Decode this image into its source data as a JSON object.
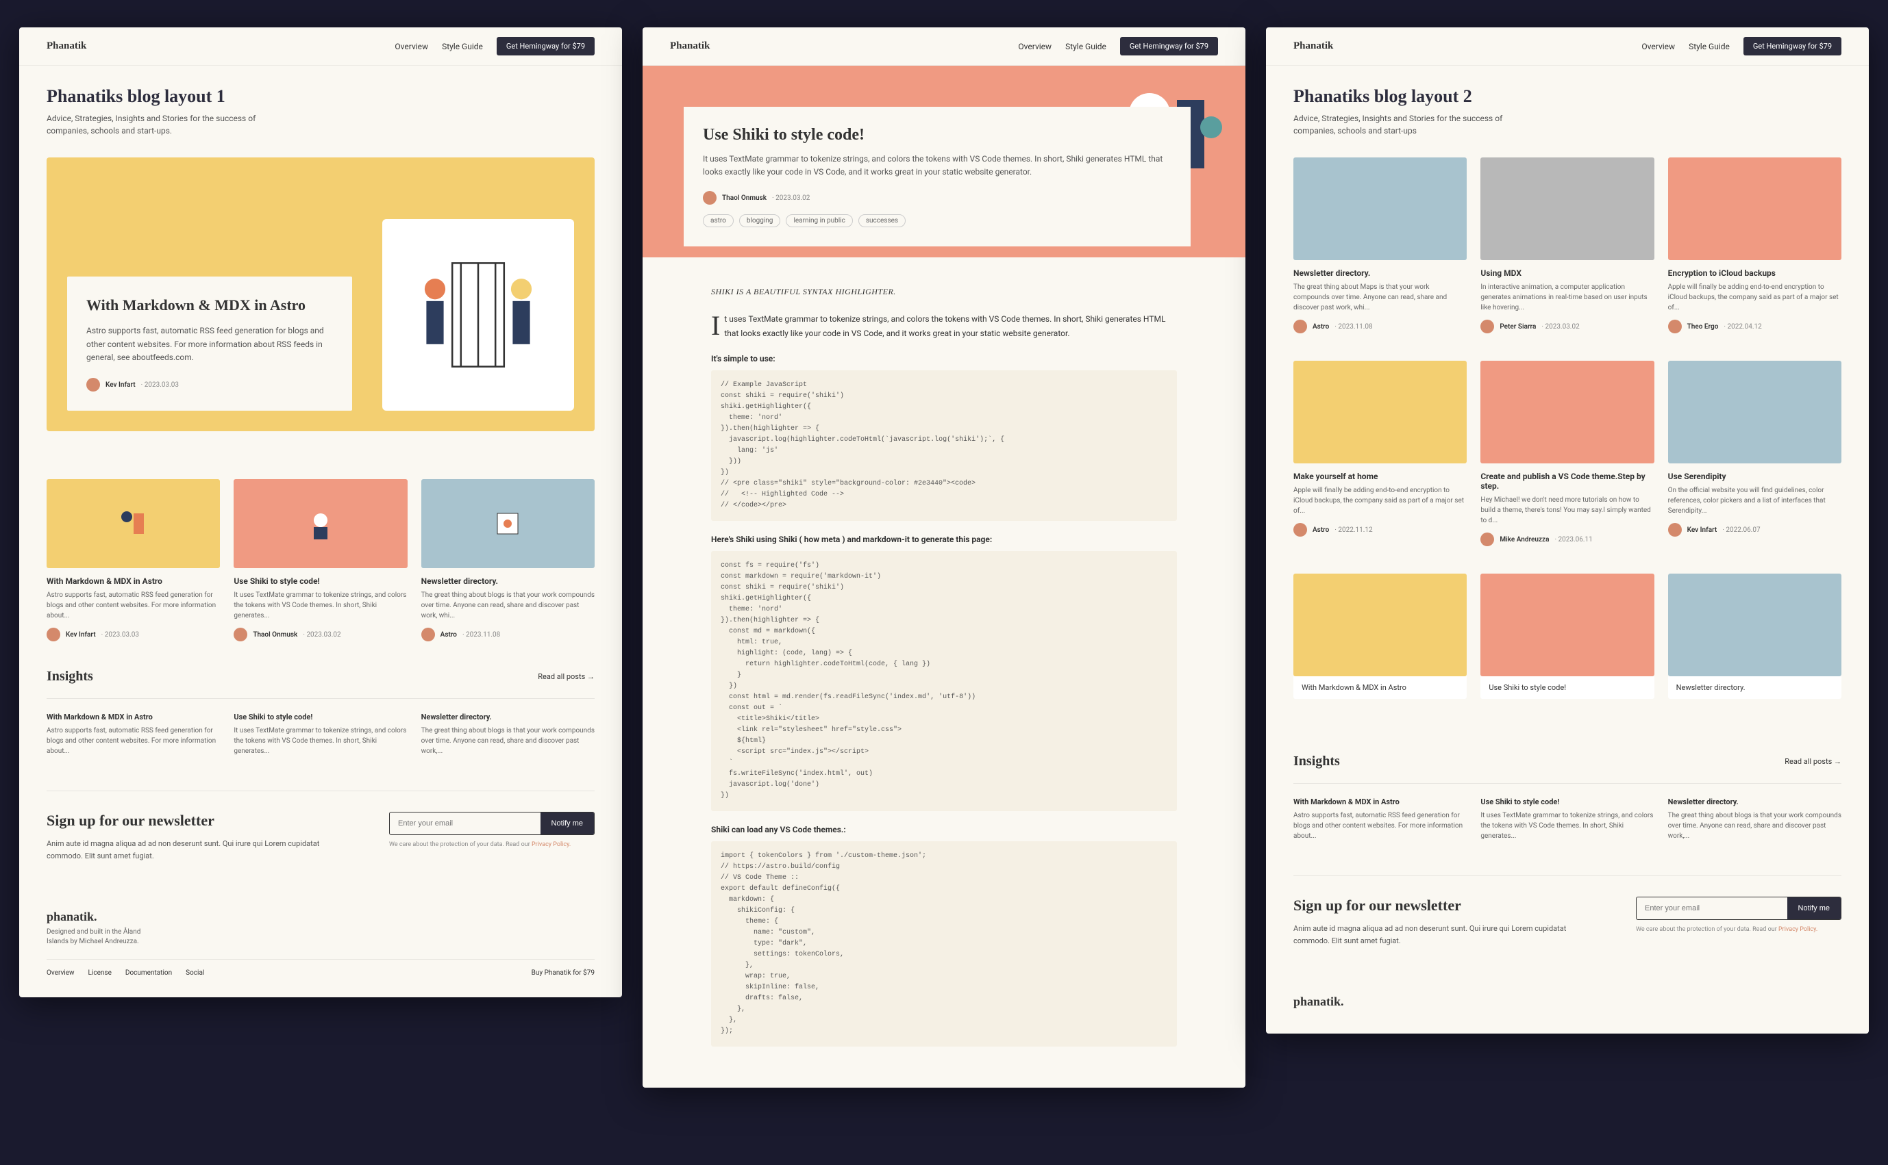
{
  "nav": {
    "logo": "Phanatik",
    "links": [
      "Overview",
      "Style Guide"
    ],
    "cta": "Get Hemingway for $79"
  },
  "page1": {
    "title": "Phanatiks blog layout 1",
    "subtitle": "Advice, Strategies, Insights and Stories for the success of companies, schools and start-ups.",
    "hero": {
      "title": "With Markdown & MDX in Astro",
      "desc": "Astro supports fast, automatic RSS feed generation for blogs and other content websites. For more information about RSS feeds in general, see aboutfeeds.com.",
      "author": "Kev Infart",
      "date": "2023.03.03"
    },
    "cards": [
      {
        "title": "With Markdown & MDX in Astro",
        "desc": "Astro supports fast, automatic RSS feed generation for blogs and other content websites. For more information about...",
        "author": "Kev Infart",
        "date": "2023.03.03",
        "color": "yellow"
      },
      {
        "title": "Use Shiki to style code!",
        "desc": "It uses TextMate grammar to tokenize strings, and colors the tokens with VS Code themes. In short, Shiki generates...",
        "author": "Thaol Onmusk",
        "date": "2023.03.02",
        "color": "salmon"
      },
      {
        "title": "Newsletter directory.",
        "desc": "The great thing about blogs is that your work compounds over time. Anyone can read, share and discover past work, whi...",
        "author": "Astro",
        "date": "2023.11.08",
        "color": "blue"
      }
    ],
    "insights_title": "Insights",
    "readall": "Read all posts →",
    "insights": [
      {
        "title": "With Markdown & MDX in Astro",
        "desc": "Astro supports fast, automatic RSS feed generation for blogs and other content websites. For more information about..."
      },
      {
        "title": "Use Shiki to style code!",
        "desc": "It uses TextMate grammar to tokenize strings, and colors the tokens with VS Code themes. In short, Shiki generates..."
      },
      {
        "title": "Newsletter directory.",
        "desc": "The great thing about blogs is that your work compounds over time. Anyone can read, share and discover past work,..."
      }
    ]
  },
  "newsletter": {
    "title": "Sign up for our newsletter",
    "desc": "Anim aute id magna aliqua ad ad non deserunt sunt. Qui irure qui Lorem cupidatat commodo. Elit sunt amet fugiat.",
    "placeholder": "Enter your email",
    "button": "Notify me",
    "privacy": "We care about the protection of your data. Read our ",
    "privacy_link": "Privacy Policy."
  },
  "footer": {
    "logo": "phanatik.",
    "line1": "Designed and built in the Åland",
    "line2": "Islands by Michael Andreuzza.",
    "nav": [
      "Overview",
      "License",
      "Documentation",
      "Social"
    ],
    "buy": "Buy Phanatik for $79"
  },
  "page2": {
    "hero": {
      "title": "Use Shiki to style code!",
      "desc": "It uses TextMate grammar to tokenize strings, and colors the tokens with VS Code themes. In short, Shiki generates HTML that looks exactly like your code in VS Code, and it works great in your static website generator.",
      "author": "Thaol Onmusk",
      "date": "2023.03.02",
      "tags": [
        "astro",
        "blogging",
        "learning in public",
        "successes"
      ]
    },
    "quote": "SHIKI IS A BEAUTIFUL SYNTAX HIGHLIGHTER.",
    "intro": "It uses TextMate grammar to tokenize strings, and colors the tokens with VS Code themes. In short, Shiki generates HTML that looks exactly like your code in VS Code, and it works great in your static website generator.",
    "sub1": "It's simple to use:",
    "code1": "// Example JavaScript\nconst shiki = require('shiki')\nshiki.getHighlighter({\n  theme: 'nord'\n}).then(highlighter => {\n  javascript.log(highlighter.codeToHtml(`javascript.log('shiki');`, {\n    lang: 'js'\n  }))\n})\n// <pre class=\"shiki\" style=\"background-color: #2e3440\"><code>\n//   <!-- Highlighted Code -->\n// </code></pre>",
    "sub2": "Here's Shiki using Shiki ( how meta ) and markdown-it to generate this page:",
    "code2": "const fs = require('fs')\nconst markdown = require('markdown-it')\nconst shiki = require('shiki')\nshiki.getHighlighter({\n  theme: 'nord'\n}).then(highlighter => {\n  const md = markdown({\n    html: true,\n    highlight: (code, lang) => {\n      return highlighter.codeToHtml(code, { lang })\n    }\n  })\n  const html = md.render(fs.readFileSync('index.md', 'utf-8'))\n  const out = `\n    <title>Shiki</title>\n    <link rel=\"stylesheet\" href=\"style.css\">\n    ${html}\n    <script src=\"index.js\"></script>\n  `\n  fs.writeFileSync('index.html', out)\n  javascript.log('done')\n})",
    "sub3": "Shiki can load any VS Code themes.:",
    "code3": "import { tokenColors } from './custom-theme.json';\n// https://astro.build/config\n// VS Code Theme ::\nexport default defineConfig({\n  markdown: {\n    shikiConfig: {\n      theme: {\n        name: \"custom\",\n        type: \"dark\",\n        settings: tokenColors,\n      },\n      wrap: true,\n      skipInline: false,\n      drafts: false,\n    },\n  },\n});"
  },
  "page3": {
    "title": "Phanatiks blog layout 2",
    "subtitle": "Advice, Strategies, Insights and Stories for the success of companies, schools and start-ups",
    "grid1": [
      {
        "title": "Newsletter directory.",
        "desc": "The great thing about Maps is that your work compounds over time. Anyone can read, share and discover past work, whi...",
        "author": "Astro",
        "date": "2023.11.08",
        "color": "blue"
      },
      {
        "title": "Using MDX",
        "desc": "In interactive animation, a computer application generates animations in real-time based on user inputs like hovering...",
        "author": "Peter Siarra",
        "date": "2023.03.02",
        "color": "gray"
      },
      {
        "title": "Encryption to iCloud backups",
        "desc": "Apple will finally be adding end-to-end encryption to iCloud backups, the company said as part of a major set of...",
        "author": "Theo Ergo",
        "date": "2022.04.12",
        "color": "salmon"
      }
    ],
    "grid2": [
      {
        "title": "Make yourself at home",
        "desc": "Apple will finally be adding end-to-end encryption to iCloud backups, the company said as part of a major set of...",
        "author": "Astro",
        "date": "2022.11.12",
        "color": "yellow"
      },
      {
        "title": "Create and publish a VS Code theme.Step by step.",
        "desc": "Hey Michael! we don't need more tutorials on how to build a theme, there's tons! You may say.I simply wanted to d...",
        "author": "Mike Andreuzza",
        "date": "2023.06.11",
        "color": "salmon"
      },
      {
        "title": "Use Serendipity",
        "desc": "On the official website you will find guidelines, color references, color pickers and a list of interfaces that Serendipity...",
        "author": "Kev Infart",
        "date": "2022.06.07",
        "color": "blue"
      }
    ],
    "grid3": [
      {
        "title": "With Markdown & MDX in Astro",
        "color": "yellow"
      },
      {
        "title": "Use Shiki to style code!",
        "color": "salmon"
      },
      {
        "title": "Newsletter directory.",
        "color": "blue"
      }
    ],
    "insights_title": "Insights",
    "readall": "Read all posts →",
    "insights": [
      {
        "title": "With Markdown & MDX in Astro",
        "desc": "Astro supports fast, automatic RSS feed generation for blogs and other content websites. For more information about..."
      },
      {
        "title": "Use Shiki to style code!",
        "desc": "It uses TextMate grammar to tokenize strings, and colors the tokens with VS Code themes. In short, Shiki generates..."
      },
      {
        "title": "Newsletter directory.",
        "desc": "The great thing about blogs is that your work compounds over time. Anyone can read, share and discover past work,..."
      }
    ]
  }
}
